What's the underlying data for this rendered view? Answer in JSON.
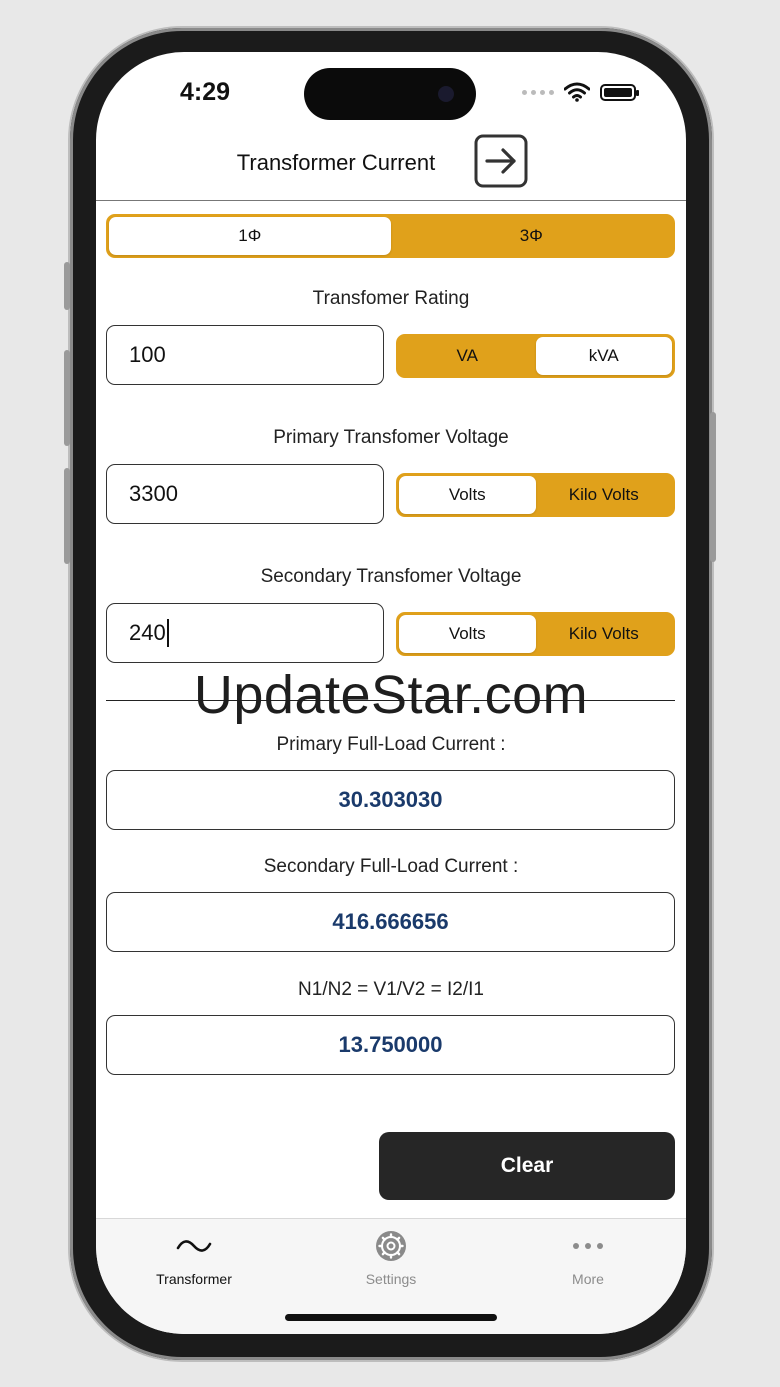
{
  "status": {
    "time": "4:29"
  },
  "nav": {
    "title": "Transformer Current",
    "action_icon": "arrow-right-square-icon"
  },
  "phase": {
    "options": [
      "1Φ",
      "3Φ"
    ],
    "selected": "1Φ"
  },
  "rating": {
    "label": "Transfomer Rating",
    "value": "100",
    "units": [
      "VA",
      "kVA"
    ],
    "selected_unit": "kVA"
  },
  "primary_voltage": {
    "label": "Primary Transfomer Voltage",
    "value": "3300",
    "units": [
      "Volts",
      "Kilo Volts"
    ],
    "selected_unit": "Volts"
  },
  "secondary_voltage": {
    "label": "Secondary Transfomer Voltage",
    "value": "240",
    "units": [
      "Volts",
      "Kilo Volts"
    ],
    "selected_unit": "Volts"
  },
  "watermark": "UpdateStar.com",
  "results": {
    "primary": {
      "label": "Primary Full-Load Current :",
      "value": "30.303030"
    },
    "secondary": {
      "label": "Secondary Full-Load Current :",
      "value": "416.666656"
    },
    "ratio": {
      "label": "N1/N2 = V1/V2 = I2/I1",
      "value": "13.750000"
    }
  },
  "clear_label": "Clear",
  "tabs": [
    {
      "label": "Transformer",
      "icon": "wave-icon",
      "active": true
    },
    {
      "label": "Settings",
      "icon": "gear-icon",
      "active": false
    },
    {
      "label": "More",
      "icon": "more-dots-icon",
      "active": false
    }
  ],
  "colors": {
    "accent": "#e0a11b",
    "result_text": "#1a3a6b",
    "button_dark": "#262626"
  }
}
